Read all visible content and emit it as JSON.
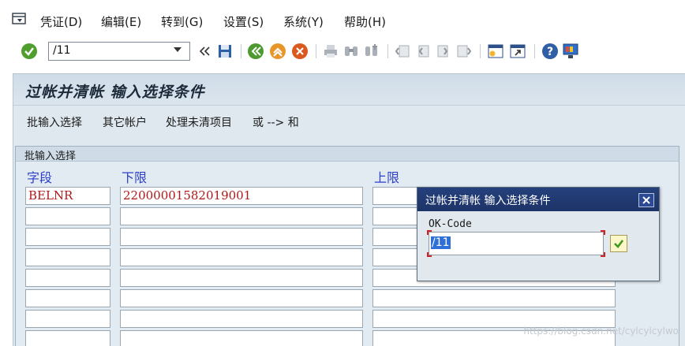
{
  "menu": {
    "items": [
      {
        "label": "凭证(D)"
      },
      {
        "label": "编辑(E)"
      },
      {
        "label": "转到(G)"
      },
      {
        "label": "设置(S)"
      },
      {
        "label": "系统(Y)"
      },
      {
        "label": "帮助(H)"
      }
    ]
  },
  "toolbar": {
    "command_value": "/11",
    "icons": [
      "enter-icon",
      "back-double-icon",
      "save-icon",
      "back-icon",
      "exit-icon",
      "cancel-icon",
      "print-icon",
      "find-icon",
      "find-next-icon",
      "first-page-icon",
      "prev-page-icon",
      "next-page-icon",
      "last-page-icon",
      "new-session-icon",
      "shortcut-icon",
      "help-icon",
      "layout-icon"
    ]
  },
  "page": {
    "title": "过帐并清帐 输入选择条件",
    "app_toolbar": [
      "批输入选择",
      "其它帐户",
      "处理未清项目",
      "或 --> 和"
    ]
  },
  "group": {
    "title": "批输入选择",
    "columns": [
      "字段",
      "下限",
      "上限"
    ],
    "rows": [
      {
        "field": "BELNR",
        "low": "22000001582019001",
        "high": ""
      },
      {
        "field": "",
        "low": "",
        "high": ""
      },
      {
        "field": "",
        "low": "",
        "high": ""
      },
      {
        "field": "",
        "low": "",
        "high": ""
      },
      {
        "field": "",
        "low": "",
        "high": ""
      },
      {
        "field": "",
        "low": "",
        "high": ""
      },
      {
        "field": "",
        "low": "",
        "high": ""
      },
      {
        "field": "",
        "low": "",
        "high": ""
      }
    ]
  },
  "dialog": {
    "title": "过帐并清帐  输入选择条件",
    "label": "OK-Code",
    "value": "/11"
  },
  "watermark": "https://blog.csdn.net/cylcylcylwo",
  "colors": {
    "accent_blue": "#2b3fc9",
    "value_red": "#b01818",
    "dialog_title_bg": "#1d3468"
  }
}
